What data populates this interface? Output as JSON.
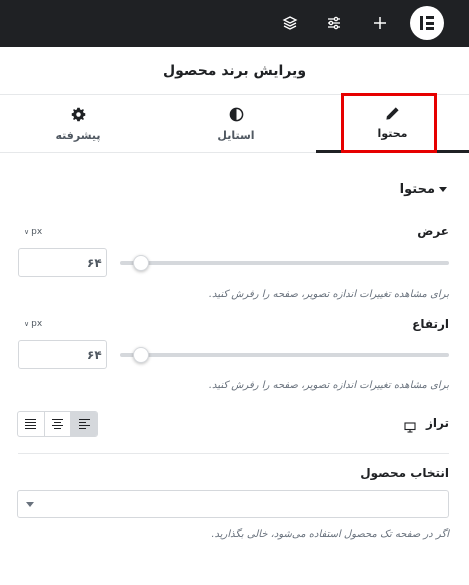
{
  "topbar": {
    "icons": [
      "layers-icon",
      "sliders-icon",
      "plus-icon",
      "elementor-logo"
    ]
  },
  "panel": {
    "title": "ویرایش برند محصول"
  },
  "tabs": [
    {
      "label": "محتوا",
      "icon": "pencil-icon",
      "active": true
    },
    {
      "label": "استایل",
      "icon": "half-circle-icon",
      "active": false
    },
    {
      "label": "پیشرفته",
      "icon": "gear-icon",
      "active": false
    }
  ],
  "section": {
    "title": "محتوا"
  },
  "width_control": {
    "label": "عرض",
    "unit": "px",
    "value": "۶۴",
    "description": "برای مشاهده تغییرات اندازه تصویر، صفحه را رفرش کنید."
  },
  "height_control": {
    "label": "ارتفاع",
    "unit": "px",
    "value": "۶۴",
    "description": "برای مشاهده تغییرات اندازه تصویر، صفحه را رفرش کنید."
  },
  "align_control": {
    "label": "تراز",
    "device_icon": "desktop-icon",
    "options": [
      "justify",
      "center",
      "left"
    ],
    "selected": "left"
  },
  "product_select": {
    "label": "انتخاب محصول",
    "value": "",
    "description": "اگر در صفحه تک محصول استفاده می‌شود، خالی بگذارید."
  },
  "colors": {
    "topbar_bg": "#1f2124",
    "highlight": "#e60000",
    "border": "#d5d8dc"
  }
}
